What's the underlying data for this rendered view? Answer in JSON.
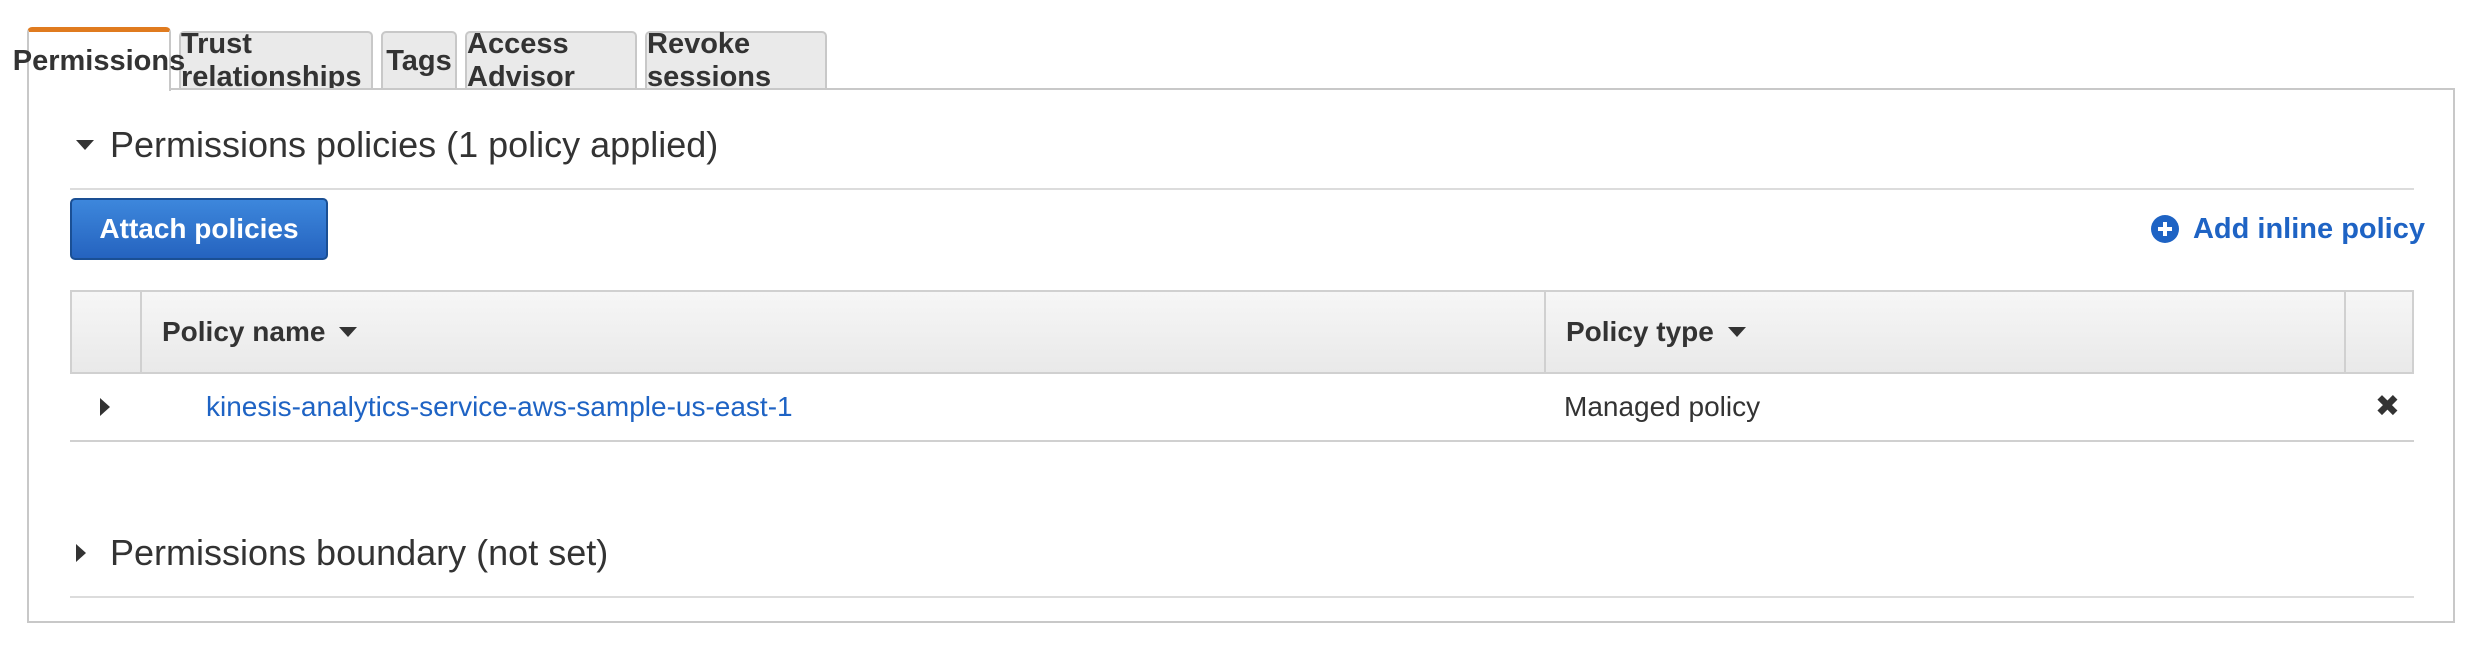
{
  "tabs": [
    {
      "label": "Permissions",
      "active": true
    },
    {
      "label": "Trust relationships",
      "active": false
    },
    {
      "label": "Tags",
      "active": false
    },
    {
      "label": "Access Advisor",
      "active": false
    },
    {
      "label": "Revoke sessions",
      "active": false
    }
  ],
  "permissions_policies": {
    "title": "Permissions policies (1 policy applied)",
    "expanded": true,
    "attach_button": "Attach policies",
    "add_inline_link": "Add inline policy",
    "table": {
      "columns": [
        "Policy name",
        "Policy type"
      ],
      "rows": [
        {
          "name": "kinesis-analytics-service-aws-sample-us-east-1",
          "type": "Managed policy"
        }
      ]
    }
  },
  "permissions_boundary": {
    "title": "Permissions boundary (not set)",
    "expanded": false
  },
  "icons": {
    "section_expanded": "caret-down-icon",
    "section_collapsed": "caret-right-icon",
    "add_inline": "plus-circle-icon",
    "remove": "close-x-icon",
    "sort": "sort-caret-icon"
  },
  "colors": {
    "active_tab_accent": "#e07b1f",
    "primary_button": "#2b6fcf",
    "link": "#1e63c4"
  }
}
